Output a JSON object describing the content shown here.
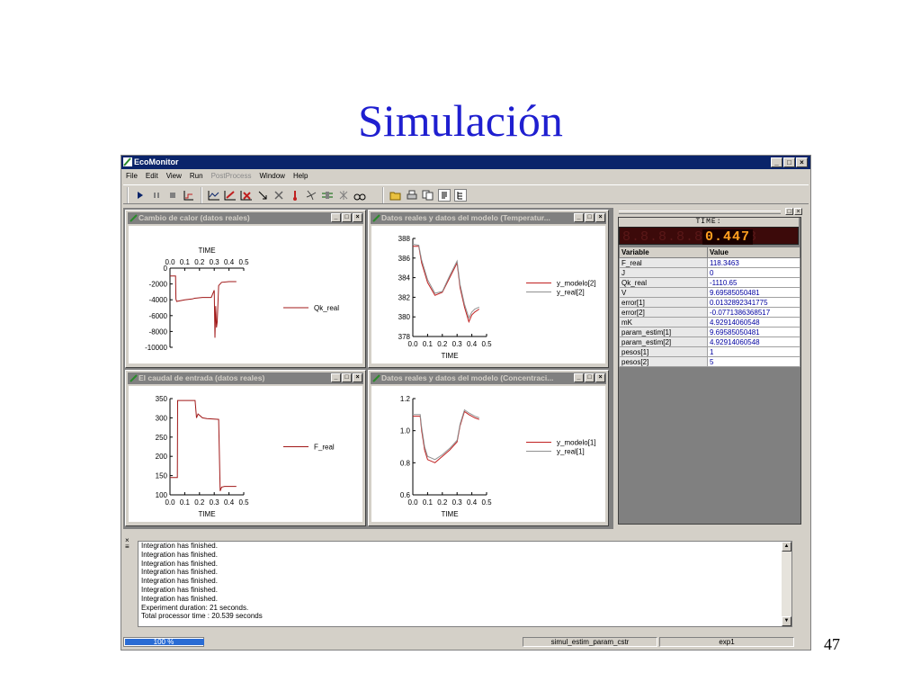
{
  "slide": {
    "title": "Simulación",
    "page_number": "47"
  },
  "window": {
    "title": "EcoMonitor",
    "controls": [
      "_",
      "□",
      "×"
    ]
  },
  "menu": [
    "File",
    "Edit",
    "View",
    "Run",
    "PostProcess",
    "Window",
    "Help"
  ],
  "menu_disabled": [
    "PostProcess"
  ],
  "toolbar_icons": [
    [
      "play-icon",
      "pause-icon",
      "stop-icon",
      "step-chart-icon"
    ],
    [
      "plot-icon",
      "plot-edit-icon",
      "plot-delete-icon",
      "arrow-icon",
      "tools-icon",
      "thermometer-icon",
      "fan-icon",
      "valve-icon",
      "scissors-icon",
      "glasses-icon"
    ],
    [
      "open-folder-icon",
      "print-icon",
      "copy-icon",
      "text-window-icon",
      "tree-icon"
    ]
  ],
  "plots": [
    {
      "window_title": "Cambio de calor (datos reales)",
      "chart_data": {
        "type": "line",
        "title": "TIME",
        "x_ticks": [
          "0.0",
          "0.1",
          "0.2",
          "0.3",
          "0.4",
          "0.5"
        ],
        "y_ticks": [
          "0",
          "-2000",
          "-4000",
          "-6000",
          "-8000",
          "-10000"
        ],
        "xlim": [
          0,
          0.5
        ],
        "ylim": [
          -10000,
          0
        ],
        "x_axis_position": "top",
        "series": [
          {
            "name": "Qk_real",
            "color": "#a01818",
            "x": [
              0,
              0.038,
              0.04,
              0.045,
              0.1,
              0.15,
              0.17,
              0.175,
              0.22,
              0.28,
              0.3,
              0.305,
              0.31,
              0.315,
              0.32,
              0.33,
              0.35,
              0.4,
              0.45
            ],
            "y": [
              -1000,
              -1000,
              -3900,
              -4200,
              -4000,
              -3900,
              -3800,
              -3800,
              -3700,
              -3700,
              -2800,
              -8800,
              -4800,
              -7500,
              -6800,
              -2200,
              -1800,
              -1700,
              -1700
            ]
          }
        ]
      }
    },
    {
      "window_title": "Datos reales y datos del modelo (Temperatur...",
      "chart_data": {
        "type": "line",
        "xlabel": "TIME",
        "x_ticks": [
          "0.0",
          "0.1",
          "0.2",
          "0.3",
          "0.4",
          "0.5"
        ],
        "y_ticks": [
          "378",
          "380",
          "382",
          "384",
          "386",
          "388"
        ],
        "xlim": [
          0,
          0.5
        ],
        "ylim": [
          378,
          388
        ],
        "series": [
          {
            "name": "y_modelo[2]",
            "color": "#c02020",
            "x": [
              0,
              0.04,
              0.06,
              0.1,
              0.15,
              0.2,
              0.25,
              0.3,
              0.32,
              0.35,
              0.38,
              0.4,
              0.42,
              0.45
            ],
            "y": [
              387.2,
              387.2,
              385.5,
              383.5,
              382.2,
              382.5,
              384.0,
              385.5,
              383.0,
              381.0,
              379.5,
              380.2,
              380.5,
              380.8
            ]
          },
          {
            "name": "y_real[2]",
            "color": "#909090",
            "x": [
              0,
              0.04,
              0.06,
              0.1,
              0.15,
              0.2,
              0.25,
              0.3,
              0.32,
              0.35,
              0.38,
              0.4,
              0.42,
              0.45
            ],
            "y": [
              387.4,
              387.3,
              385.8,
              383.8,
              382.4,
              382.6,
              384.2,
              385.7,
              383.3,
              381.3,
              379.9,
              380.5,
              380.8,
              381.0
            ]
          }
        ]
      }
    },
    {
      "window_title": "El caudal de entrada (datos reales)",
      "chart_data": {
        "type": "line",
        "xlabel": "TIME",
        "x_ticks": [
          "0.0",
          "0.1",
          "0.2",
          "0.3",
          "0.4",
          "0.5"
        ],
        "y_ticks": [
          "100",
          "150",
          "200",
          "250",
          "300",
          "350"
        ],
        "xlim": [
          0,
          0.5
        ],
        "ylim": [
          100,
          350
        ],
        "series": [
          {
            "name": "F_real",
            "color": "#a01818",
            "x": [
              0,
              0.05,
              0.052,
              0.1,
              0.17,
              0.18,
              0.19,
              0.22,
              0.25,
              0.33,
              0.34,
              0.35,
              0.37,
              0.45
            ],
            "y": [
              145,
              145,
              345,
              345,
              345,
              300,
              310,
              300,
              298,
              296,
              110,
              120,
              122,
              122
            ]
          }
        ]
      }
    },
    {
      "window_title": "Datos reales y datos del modelo (Concentraci...",
      "chart_data": {
        "type": "line",
        "xlabel": "TIME",
        "x_ticks": [
          "0.0",
          "0.1",
          "0.2",
          "0.3",
          "0.4",
          "0.5"
        ],
        "y_ticks": [
          "0.6",
          "0.8",
          "1.0",
          "1.2"
        ],
        "xlim": [
          0,
          0.5
        ],
        "ylim": [
          0.6,
          1.2
        ],
        "series": [
          {
            "name": "y_modelo[1]",
            "color": "#c02020",
            "x": [
              0,
              0.05,
              0.06,
              0.08,
              0.1,
              0.15,
              0.2,
              0.25,
              0.3,
              0.32,
              0.35,
              0.38,
              0.42,
              0.45
            ],
            "y": [
              1.09,
              1.09,
              1.0,
              0.88,
              0.82,
              0.8,
              0.84,
              0.88,
              0.93,
              1.03,
              1.12,
              1.1,
              1.08,
              1.07
            ]
          },
          {
            "name": "y_real[1]",
            "color": "#909090",
            "x": [
              0,
              0.05,
              0.06,
              0.08,
              0.1,
              0.15,
              0.2,
              0.25,
              0.3,
              0.32,
              0.35,
              0.38,
              0.42,
              0.45
            ],
            "y": [
              1.1,
              1.1,
              1.02,
              0.9,
              0.84,
              0.82,
              0.85,
              0.89,
              0.94,
              1.04,
              1.13,
              1.11,
              1.09,
              1.08
            ]
          }
        ]
      }
    }
  ],
  "watch": {
    "time_label": "TIME:",
    "time_ghost": "8.8.8.8.8.8.8.8",
    "time_value": "0.447",
    "columns": [
      "Variable",
      "Value"
    ],
    "rows": [
      [
        "F_real",
        "118.3463"
      ],
      [
        "J",
        "0"
      ],
      [
        "Qk_real",
        "-1110.65"
      ],
      [
        "V",
        "9.69585050481"
      ],
      [
        "error[1]",
        "0.0132892341775"
      ],
      [
        "error[2]",
        "-0.0771386368517"
      ],
      [
        "mK",
        "4.92914060548"
      ],
      [
        "param_estim[1]",
        "9.69585050481"
      ],
      [
        "param_estim[2]",
        "4.92914060548"
      ],
      [
        "pesos[1]",
        "1"
      ],
      [
        "pesos[2]",
        "5"
      ]
    ]
  },
  "log": {
    "lines": [
      "Integration has finished.",
      "Integration has finished.",
      "Integration has finished.",
      "Integration has finished.",
      "Integration has finished.",
      "Integration has finished.",
      "Integration has finished.",
      "Experiment duration: 21 seconds.",
      "Total processor time : 20.539 seconds"
    ]
  },
  "status": {
    "progress_label": "100 %",
    "progress": 1.0,
    "model": "simul_estim_param_cstr",
    "experiment": "exp1"
  }
}
